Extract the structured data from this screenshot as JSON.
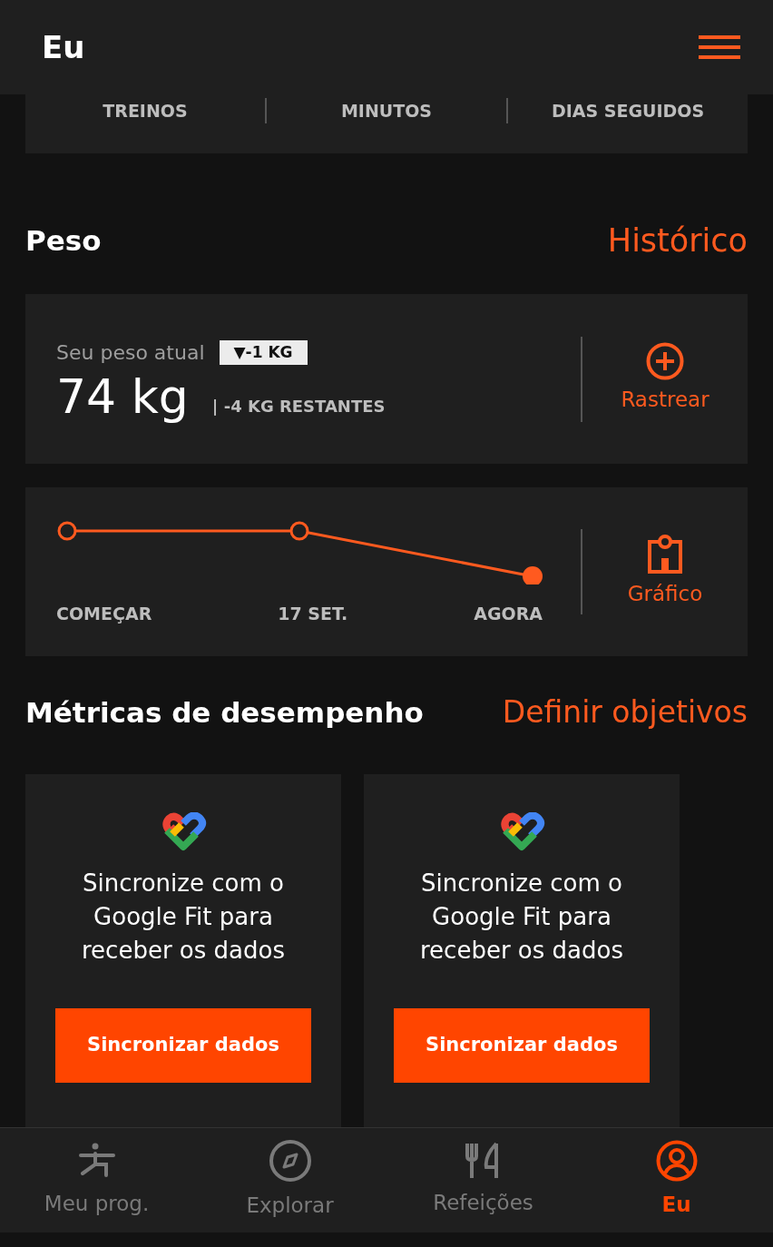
{
  "header": {
    "title": "Eu"
  },
  "stats": {
    "labels": [
      "TREINOS",
      "MINUTOS",
      "DIAS SEGUIDOS"
    ]
  },
  "weight": {
    "title": "Peso",
    "link": "Histórico",
    "label": "Seu peso atual",
    "change_badge": "▼-1 KG",
    "value": "74 kg",
    "remaining": "| -4 KG RESTANTES",
    "action": "Rastrear"
  },
  "trend": {
    "labels": [
      "COMEÇAR",
      "17 SET.",
      "AGORA"
    ],
    "action": "Gráfico"
  },
  "metrics": {
    "title": "Métricas de desempenho",
    "link": "Definir objetivos",
    "cards": [
      {
        "text": "Sincronize com o Google Fit para receber os dados",
        "button": "Sincronizar dados"
      },
      {
        "text": "Sincronize com o Google Fit para receber os dados",
        "button": "Sincronizar dados"
      }
    ]
  },
  "nav": [
    {
      "kind": "exercise",
      "label": "Meu prog.",
      "selected": false
    },
    {
      "kind": "compass",
      "label": "Explorar",
      "selected": false
    },
    {
      "kind": "meals",
      "label": "Refeições",
      "selected": false
    },
    {
      "kind": "profile",
      "label": "Eu",
      "selected": true
    }
  ]
}
